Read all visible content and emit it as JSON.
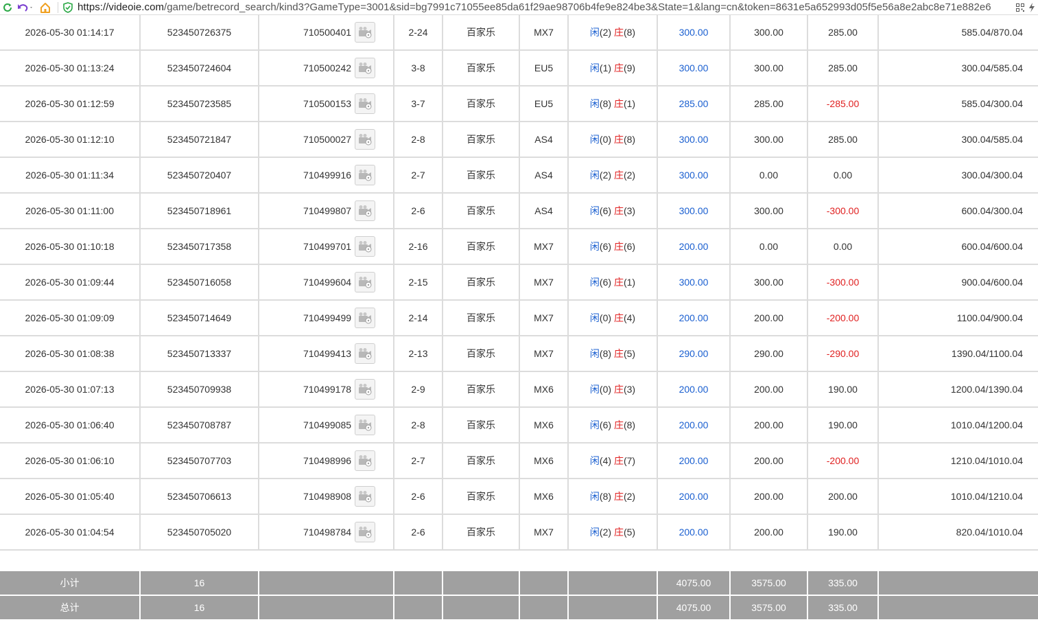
{
  "browser": {
    "url_scheme": "https://",
    "url_host": "videoie.com",
    "url_rest": "/game/betrecord_search/kind3?GameType=3001&sid=bg7991c71055ee85da61f29ae98706b4fe9e824be3&State=1&lang=cn&token=8631e5a652993d05f5e56a8e2abc8e71e882e6",
    "icons": [
      "refresh-icon",
      "undo-icon",
      "home-icon",
      "shield-icon",
      "qr-icon",
      "lightning-icon"
    ],
    "accent_green": "#2aa845",
    "accent_purple": "#7a3fd0",
    "accent_orange": "#f0a020"
  },
  "colors": {
    "blue": "#1a5fd0",
    "red": "#e02020",
    "sum_bg": "#a0a0a0",
    "grid": "#dcdcdc"
  },
  "rows": [
    {
      "time": "2026-05-30 01:14:17",
      "order": "523450726375",
      "game": "710500401",
      "round": "2-24",
      "type": "百家乐",
      "table": "MX7",
      "p_label": "闲",
      "p_val": "(2)",
      "b_label": "庄",
      "b_val": "(8)",
      "bet": "300.00",
      "valid": "300.00",
      "win": "285.00",
      "win_neg": false,
      "balance": "585.04/870.04"
    },
    {
      "time": "2026-05-30 01:13:24",
      "order": "523450724604",
      "game": "710500242",
      "round": "3-8",
      "type": "百家乐",
      "table": "EU5",
      "p_label": "闲",
      "p_val": "(1)",
      "b_label": "庄",
      "b_val": "(9)",
      "bet": "300.00",
      "valid": "300.00",
      "win": "285.00",
      "win_neg": false,
      "balance": "300.04/585.04"
    },
    {
      "time": "2026-05-30 01:12:59",
      "order": "523450723585",
      "game": "710500153",
      "round": "3-7",
      "type": "百家乐",
      "table": "EU5",
      "p_label": "闲",
      "p_val": "(8)",
      "b_label": "庄",
      "b_val": "(1)",
      "bet": "285.00",
      "valid": "285.00",
      "win": "-285.00",
      "win_neg": true,
      "balance": "585.04/300.04"
    },
    {
      "time": "2026-05-30 01:12:10",
      "order": "523450721847",
      "game": "710500027",
      "round": "2-8",
      "type": "百家乐",
      "table": "AS4",
      "p_label": "闲",
      "p_val": "(0)",
      "b_label": "庄",
      "b_val": "(8)",
      "bet": "300.00",
      "valid": "300.00",
      "win": "285.00",
      "win_neg": false,
      "balance": "300.04/585.04"
    },
    {
      "time": "2026-05-30 01:11:34",
      "order": "523450720407",
      "game": "710499916",
      "round": "2-7",
      "type": "百家乐",
      "table": "AS4",
      "p_label": "闲",
      "p_val": "(2)",
      "b_label": "庄",
      "b_val": "(2)",
      "bet": "300.00",
      "valid": "0.00",
      "win": "0.00",
      "win_neg": false,
      "balance": "300.04/300.04"
    },
    {
      "time": "2026-05-30 01:11:00",
      "order": "523450718961",
      "game": "710499807",
      "round": "2-6",
      "type": "百家乐",
      "table": "AS4",
      "p_label": "闲",
      "p_val": "(6)",
      "b_label": "庄",
      "b_val": "(3)",
      "bet": "300.00",
      "valid": "300.00",
      "win": "-300.00",
      "win_neg": true,
      "balance": "600.04/300.04"
    },
    {
      "time": "2026-05-30 01:10:18",
      "order": "523450717358",
      "game": "710499701",
      "round": "2-16",
      "type": "百家乐",
      "table": "MX7",
      "p_label": "闲",
      "p_val": "(6)",
      "b_label": "庄",
      "b_val": "(6)",
      "bet": "200.00",
      "valid": "0.00",
      "win": "0.00",
      "win_neg": false,
      "balance": "600.04/600.04"
    },
    {
      "time": "2026-05-30 01:09:44",
      "order": "523450716058",
      "game": "710499604",
      "round": "2-15",
      "type": "百家乐",
      "table": "MX7",
      "p_label": "闲",
      "p_val": "(6)",
      "b_label": "庄",
      "b_val": "(1)",
      "bet": "300.00",
      "valid": "300.00",
      "win": "-300.00",
      "win_neg": true,
      "balance": "900.04/600.04"
    },
    {
      "time": "2026-05-30 01:09:09",
      "order": "523450714649",
      "game": "710499499",
      "round": "2-14",
      "type": "百家乐",
      "table": "MX7",
      "p_label": "闲",
      "p_val": "(0)",
      "b_label": "庄",
      "b_val": "(4)",
      "bet": "200.00",
      "valid": "200.00",
      "win": "-200.00",
      "win_neg": true,
      "balance": "1100.04/900.04"
    },
    {
      "time": "2026-05-30 01:08:38",
      "order": "523450713337",
      "game": "710499413",
      "round": "2-13",
      "type": "百家乐",
      "table": "MX7",
      "p_label": "闲",
      "p_val": "(8)",
      "b_label": "庄",
      "b_val": "(5)",
      "bet": "290.00",
      "valid": "290.00",
      "win": "-290.00",
      "win_neg": true,
      "balance": "1390.04/1100.04"
    },
    {
      "time": "2026-05-30 01:07:13",
      "order": "523450709938",
      "game": "710499178",
      "round": "2-9",
      "type": "百家乐",
      "table": "MX6",
      "p_label": "闲",
      "p_val": "(0)",
      "b_label": "庄",
      "b_val": "(3)",
      "bet": "200.00",
      "valid": "200.00",
      "win": "190.00",
      "win_neg": false,
      "balance": "1200.04/1390.04"
    },
    {
      "time": "2026-05-30 01:06:40",
      "order": "523450708787",
      "game": "710499085",
      "round": "2-8",
      "type": "百家乐",
      "table": "MX6",
      "p_label": "闲",
      "p_val": "(6)",
      "b_label": "庄",
      "b_val": "(8)",
      "bet": "200.00",
      "valid": "200.00",
      "win": "190.00",
      "win_neg": false,
      "balance": "1010.04/1200.04"
    },
    {
      "time": "2026-05-30 01:06:10",
      "order": "523450707703",
      "game": "710498996",
      "round": "2-7",
      "type": "百家乐",
      "table": "MX6",
      "p_label": "闲",
      "p_val": "(4)",
      "b_label": "庄",
      "b_val": "(7)",
      "bet": "200.00",
      "valid": "200.00",
      "win": "-200.00",
      "win_neg": true,
      "balance": "1210.04/1010.04"
    },
    {
      "time": "2026-05-30 01:05:40",
      "order": "523450706613",
      "game": "710498908",
      "round": "2-6",
      "type": "百家乐",
      "table": "MX6",
      "p_label": "闲",
      "p_val": "(8)",
      "b_label": "庄",
      "b_val": "(2)",
      "bet": "200.00",
      "valid": "200.00",
      "win": "200.00",
      "win_neg": false,
      "balance": "1010.04/1210.04"
    },
    {
      "time": "2026-05-30 01:04:54",
      "order": "523450705020",
      "game": "710498784",
      "round": "2-6",
      "type": "百家乐",
      "table": "MX7",
      "p_label": "闲",
      "p_val": "(2)",
      "b_label": "庄",
      "b_val": "(5)",
      "bet": "200.00",
      "valid": "200.00",
      "win": "190.00",
      "win_neg": false,
      "balance": "820.04/1010.04"
    }
  ],
  "subtotal": {
    "label": "小计",
    "count": "16",
    "bet": "4075.00",
    "valid": "3575.00",
    "win": "335.00"
  },
  "total": {
    "label": "总计",
    "count": "16",
    "bet": "4075.00",
    "valid": "3575.00",
    "win": "335.00"
  }
}
